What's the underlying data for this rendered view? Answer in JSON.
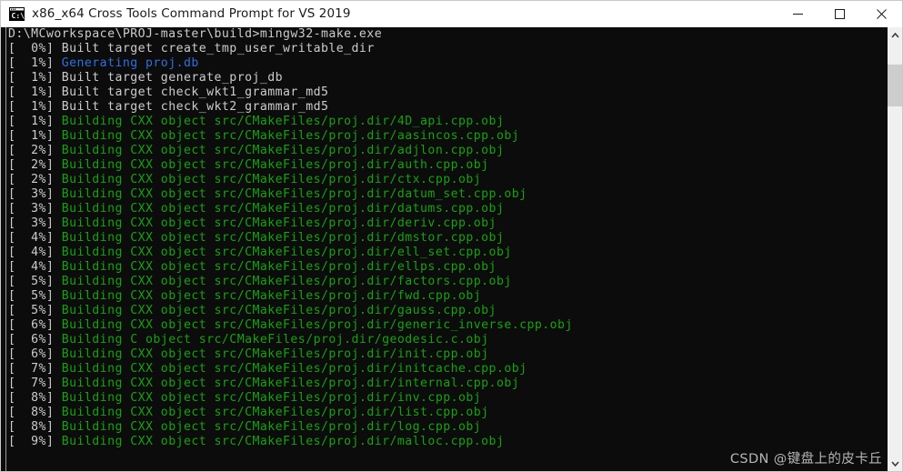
{
  "window": {
    "title": "x86_x64 Cross Tools Command Prompt for VS 2019",
    "icon": "console-icon",
    "controls": {
      "minimize": "minimize-icon",
      "maximize": "maximize-icon",
      "close": "close-icon"
    }
  },
  "colors": {
    "background": "#0c0c0c",
    "default_text": "#cccccc",
    "building_text": "#16a30f",
    "generating_text": "#2f6fdf",
    "titlebar_bg": "#ffffff",
    "scrollbar_track": "#f0f0f0",
    "scrollbar_thumb": "#cdcdcd"
  },
  "scrollbar": {
    "up_arrow": "chevron-up-icon",
    "down_arrow": "chevron-down-icon"
  },
  "watermark": "CSDN @键盘上的皮卡丘",
  "terminal": {
    "prompt_line": "D:\\MCworkspace\\PROJ-master\\build>mingw32-make.exe",
    "lines": [
      {
        "prefix": "[  0%] ",
        "text": "Built target create_tmp_user_writable_dir",
        "color": "white"
      },
      {
        "prefix": "[  1%] ",
        "text": "Generating proj.db",
        "color": "blue"
      },
      {
        "prefix": "[  1%] ",
        "text": "Built target generate_proj_db",
        "color": "white"
      },
      {
        "prefix": "[  1%] ",
        "text": "Built target check_wkt1_grammar_md5",
        "color": "white"
      },
      {
        "prefix": "[  1%] ",
        "text": "Built target check_wkt2_grammar_md5",
        "color": "white"
      },
      {
        "prefix": "[  1%] ",
        "text": "Building CXX object src/CMakeFiles/proj.dir/4D_api.cpp.obj",
        "color": "green"
      },
      {
        "prefix": "[  1%] ",
        "text": "Building CXX object src/CMakeFiles/proj.dir/aasincos.cpp.obj",
        "color": "green"
      },
      {
        "prefix": "[  2%] ",
        "text": "Building CXX object src/CMakeFiles/proj.dir/adjlon.cpp.obj",
        "color": "green"
      },
      {
        "prefix": "[  2%] ",
        "text": "Building CXX object src/CMakeFiles/proj.dir/auth.cpp.obj",
        "color": "green"
      },
      {
        "prefix": "[  2%] ",
        "text": "Building CXX object src/CMakeFiles/proj.dir/ctx.cpp.obj",
        "color": "green"
      },
      {
        "prefix": "[  3%] ",
        "text": "Building CXX object src/CMakeFiles/proj.dir/datum_set.cpp.obj",
        "color": "green"
      },
      {
        "prefix": "[  3%] ",
        "text": "Building CXX object src/CMakeFiles/proj.dir/datums.cpp.obj",
        "color": "green"
      },
      {
        "prefix": "[  3%] ",
        "text": "Building CXX object src/CMakeFiles/proj.dir/deriv.cpp.obj",
        "color": "green"
      },
      {
        "prefix": "[  4%] ",
        "text": "Building CXX object src/CMakeFiles/proj.dir/dmstor.cpp.obj",
        "color": "green"
      },
      {
        "prefix": "[  4%] ",
        "text": "Building CXX object src/CMakeFiles/proj.dir/ell_set.cpp.obj",
        "color": "green"
      },
      {
        "prefix": "[  4%] ",
        "text": "Building CXX object src/CMakeFiles/proj.dir/ellps.cpp.obj",
        "color": "green"
      },
      {
        "prefix": "[  5%] ",
        "text": "Building CXX object src/CMakeFiles/proj.dir/factors.cpp.obj",
        "color": "green"
      },
      {
        "prefix": "[  5%] ",
        "text": "Building CXX object src/CMakeFiles/proj.dir/fwd.cpp.obj",
        "color": "green"
      },
      {
        "prefix": "[  5%] ",
        "text": "Building CXX object src/CMakeFiles/proj.dir/gauss.cpp.obj",
        "color": "green"
      },
      {
        "prefix": "[  6%] ",
        "text": "Building CXX object src/CMakeFiles/proj.dir/generic_inverse.cpp.obj",
        "color": "green"
      },
      {
        "prefix": "[  6%] ",
        "text": "Building C object src/CMakeFiles/proj.dir/geodesic.c.obj",
        "color": "green"
      },
      {
        "prefix": "[  6%] ",
        "text": "Building CXX object src/CMakeFiles/proj.dir/init.cpp.obj",
        "color": "green"
      },
      {
        "prefix": "[  7%] ",
        "text": "Building CXX object src/CMakeFiles/proj.dir/initcache.cpp.obj",
        "color": "green"
      },
      {
        "prefix": "[  7%] ",
        "text": "Building CXX object src/CMakeFiles/proj.dir/internal.cpp.obj",
        "color": "green"
      },
      {
        "prefix": "[  8%] ",
        "text": "Building CXX object src/CMakeFiles/proj.dir/inv.cpp.obj",
        "color": "green"
      },
      {
        "prefix": "[  8%] ",
        "text": "Building CXX object src/CMakeFiles/proj.dir/list.cpp.obj",
        "color": "green"
      },
      {
        "prefix": "[  8%] ",
        "text": "Building CXX object src/CMakeFiles/proj.dir/log.cpp.obj",
        "color": "green"
      },
      {
        "prefix": "[  9%] ",
        "text": "Building CXX object src/CMakeFiles/proj.dir/malloc.cpp.obj",
        "color": "green"
      }
    ]
  }
}
